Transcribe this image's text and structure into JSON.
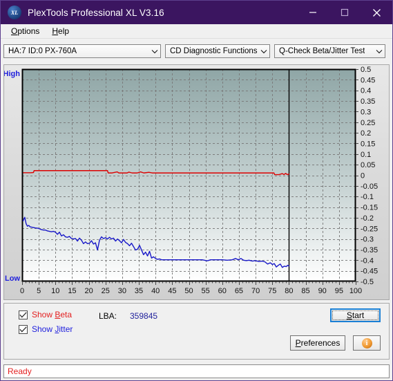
{
  "window": {
    "title": "PlexTools Professional XL V3.16",
    "icon": "XL",
    "controls": {
      "minimize": "—",
      "maximize": "□",
      "close": "✕"
    }
  },
  "menubar": {
    "items": [
      {
        "label": "Options",
        "accel": "O"
      },
      {
        "label": "Help",
        "accel": "H"
      }
    ]
  },
  "toolbar": {
    "drive_select": "HA:7 ID:0  PX-760A",
    "function_select": "CD Diagnostic Functions",
    "test_select": "Q-Check Beta/Jitter Test"
  },
  "chart_data": {
    "type": "line",
    "title": "",
    "xlabel": "",
    "ylabel": "",
    "axis_left_top_label": "High",
    "axis_left_bottom_label": "Low",
    "xlim": [
      0,
      100
    ],
    "ylim": [
      -0.5,
      0.5
    ],
    "xticks": [
      0,
      5,
      10,
      15,
      20,
      25,
      30,
      35,
      40,
      45,
      50,
      55,
      60,
      65,
      70,
      75,
      80,
      85,
      90,
      95,
      100
    ],
    "yticks": [
      0.5,
      0.45,
      0.4,
      0.35,
      0.3,
      0.25,
      0.2,
      0.15,
      0.1,
      0.05,
      0,
      -0.05,
      -0.1,
      -0.15,
      -0.2,
      -0.25,
      -0.3,
      -0.35,
      -0.4,
      -0.45,
      -0.5
    ],
    "grid": true,
    "grid_style": "dashed",
    "grid_color": "#7a7a7a",
    "plot_gradient_top": "#8fa6a6",
    "plot_gradient_bottom": "#ffffff",
    "data_end_marker_x": 80,
    "series": [
      {
        "name": "Beta",
        "color": "#dd0000",
        "x": [
          0.4,
          1.5,
          2.6,
          3.4,
          3.6,
          6,
          9,
          12,
          15,
          18,
          21,
          24,
          25.6,
          25.8,
          27,
          28.5,
          29,
          30,
          31.5,
          32,
          33,
          34.5,
          35.5,
          36.5,
          38,
          39,
          40,
          42,
          44,
          46,
          48,
          50,
          52,
          54,
          56,
          58,
          60,
          62,
          64,
          66,
          68,
          70,
          72,
          74,
          75.5,
          75.7,
          77,
          78,
          78.5,
          79,
          79.5,
          80
        ],
        "y": [
          0.012,
          0.012,
          0.012,
          0.013,
          0.022,
          0.022,
          0.022,
          0.022,
          0.022,
          0.022,
          0.022,
          0.022,
          0.022,
          0.011,
          0.011,
          0.016,
          0.011,
          0.011,
          0.011,
          0.015,
          0.011,
          0.011,
          0.016,
          0.011,
          0.014,
          0.011,
          0.011,
          0.011,
          0.011,
          0.011,
          0.011,
          0.011,
          0.011,
          0.011,
          0.011,
          0.011,
          0.011,
          0.011,
          0.011,
          0.011,
          0.011,
          0.011,
          0.011,
          0.011,
          0.011,
          0.003,
          0.003,
          0.008,
          0.003,
          0.009,
          0.003,
          0.006
        ]
      },
      {
        "name": "Jitter",
        "color": "#1818c8",
        "x": [
          0.3,
          0.8,
          1.2,
          1.6,
          2.0,
          2.4,
          2.8,
          3.4,
          4.0,
          4.6,
          5.2,
          5.8,
          6.4,
          7.0,
          7.6,
          8.2,
          8.8,
          9.4,
          10.0,
          10.6,
          11.2,
          11.8,
          12.4,
          13.0,
          13.6,
          14.2,
          14.8,
          15.4,
          16.0,
          16.6,
          17.2,
          17.8,
          18.4,
          19.0,
          19.6,
          20.2,
          20.8,
          21.4,
          22.0,
          22.6,
          23.2,
          23.8,
          24.4,
          25.0,
          25.6,
          26.2,
          26.8,
          27.4,
          28.0,
          28.6,
          29.2,
          29.8,
          30.4,
          31.0,
          31.6,
          32.2,
          32.8,
          33.4,
          34.0,
          34.6,
          35.2,
          35.8,
          36.4,
          37.0,
          37.6,
          38.2,
          38.8,
          39.4,
          40.0,
          40.6,
          41.2,
          41.8,
          42.4,
          43.0,
          43.6,
          44.2,
          45.0,
          46.5,
          48.0,
          50.0,
          52.0,
          54.0,
          55.5,
          56.5,
          57.5,
          58.5,
          60.0,
          61.5,
          63.0,
          64.0,
          64.8,
          65.6,
          66.4,
          67.2,
          68.0,
          69.0,
          70.0,
          71.0,
          72.0,
          72.8,
          73.6,
          74.4,
          75.0,
          75.6,
          76.2,
          76.8,
          77.4,
          78.0,
          78.6,
          79.2,
          79.6,
          80.0
        ],
        "y": [
          -0.215,
          -0.198,
          -0.228,
          -0.24,
          -0.236,
          -0.243,
          -0.244,
          -0.246,
          -0.248,
          -0.249,
          -0.252,
          -0.256,
          -0.258,
          -0.258,
          -0.262,
          -0.264,
          -0.266,
          -0.264,
          -0.268,
          -0.278,
          -0.268,
          -0.286,
          -0.28,
          -0.29,
          -0.292,
          -0.288,
          -0.298,
          -0.3,
          -0.298,
          -0.31,
          -0.296,
          -0.306,
          -0.322,
          -0.314,
          -0.322,
          -0.32,
          -0.308,
          -0.324,
          -0.318,
          -0.352,
          -0.306,
          -0.29,
          -0.298,
          -0.294,
          -0.3,
          -0.292,
          -0.3,
          -0.296,
          -0.31,
          -0.3,
          -0.308,
          -0.318,
          -0.302,
          -0.316,
          -0.322,
          -0.332,
          -0.32,
          -0.336,
          -0.352,
          -0.348,
          -0.33,
          -0.352,
          -0.374,
          -0.362,
          -0.38,
          -0.358,
          -0.39,
          -0.384,
          -0.392,
          -0.396,
          -0.394,
          -0.398,
          -0.398,
          -0.398,
          -0.398,
          -0.398,
          -0.398,
          -0.398,
          -0.398,
          -0.398,
          -0.398,
          -0.398,
          -0.403,
          -0.398,
          -0.398,
          -0.398,
          -0.398,
          -0.4,
          -0.398,
          -0.392,
          -0.398,
          -0.392,
          -0.4,
          -0.402,
          -0.4,
          -0.404,
          -0.402,
          -0.406,
          -0.404,
          -0.408,
          -0.418,
          -0.412,
          -0.42,
          -0.416,
          -0.432,
          -0.424,
          -0.418,
          -0.434,
          -0.428,
          -0.43,
          -0.424,
          -0.428
        ]
      }
    ]
  },
  "controls": {
    "show_beta": {
      "label_pre": "Show ",
      "accel": "B",
      "label_post": "eta",
      "checked": true
    },
    "show_jitter": {
      "label_pre": "Show ",
      "accel": "J",
      "label_post": "itter",
      "checked": true
    },
    "lba_label": "LBA:",
    "lba_value": "359845",
    "start_button": {
      "pre": "",
      "accel": "S",
      "post": "tart"
    },
    "preferences_button": {
      "pre": "",
      "accel": "P",
      "post": "references"
    },
    "info_button": "i"
  },
  "statusbar": {
    "text": "Ready"
  }
}
